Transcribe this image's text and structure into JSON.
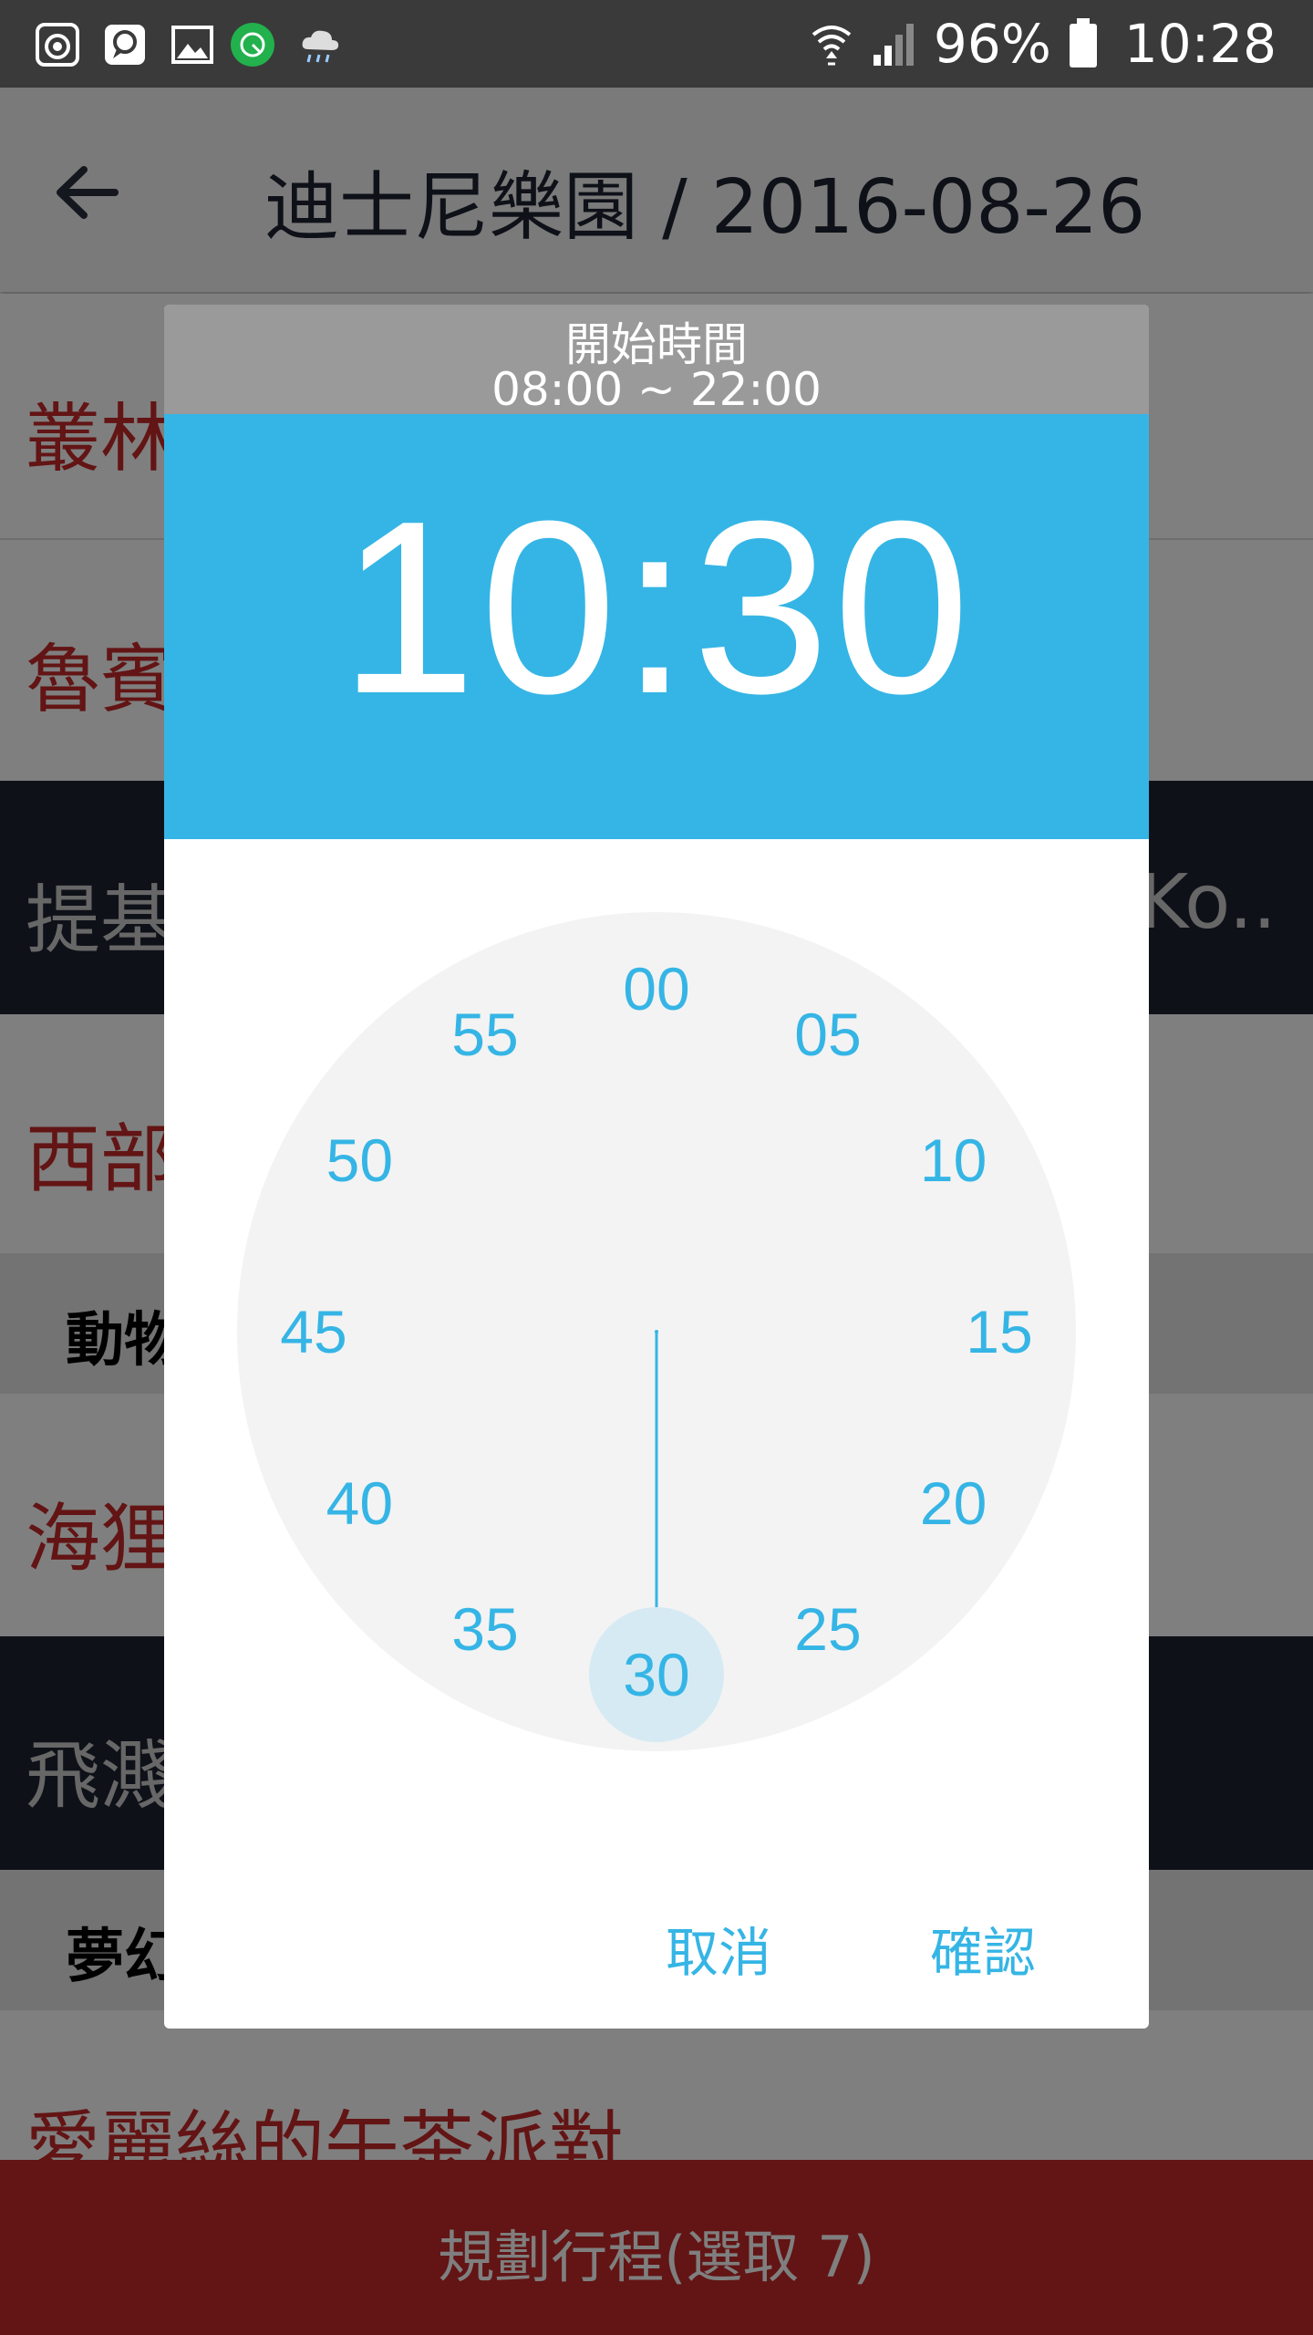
{
  "status_bar": {
    "battery": "96%",
    "time": "10:28",
    "left_icons": [
      "camera-icon",
      "message-icon",
      "gallery-icon",
      "app-icon",
      "weather-icon"
    ],
    "right_icons": [
      "wifi-icon",
      "signal-icon",
      "battery-icon"
    ]
  },
  "app_bar": {
    "title": "迪士尼樂園 / 2016-08-26"
  },
  "list": {
    "rows": [
      {
        "text": "叢林",
        "kind": "item"
      },
      {
        "text": "魯賓",
        "kind": "item"
      },
      {
        "text": "提基",
        "right_text": "Ko..",
        "kind": "dark"
      },
      {
        "text": "西部",
        "kind": "item"
      },
      {
        "text": "動物",
        "kind": "section"
      },
      {
        "text": "海狸",
        "kind": "item"
      },
      {
        "text": "飛濺",
        "kind": "dark"
      },
      {
        "text": "夢幻",
        "kind": "section"
      },
      {
        "text": "愛麗絲的午茶派對",
        "kind": "item"
      }
    ]
  },
  "bottom_bar": {
    "label": "規劃行程(選取 7)"
  },
  "dialog": {
    "title": "開始時間",
    "range": "08:00 ~ 22:00",
    "time": "10:30",
    "clock_numbers": [
      "00",
      "05",
      "10",
      "15",
      "20",
      "25",
      "30",
      "35",
      "40",
      "45",
      "50",
      "55"
    ],
    "selected_minute": "30",
    "cancel_label": "取消",
    "confirm_label": "確認"
  },
  "colors": {
    "accent": "#35b5e5",
    "red_text": "#c62828",
    "dark_row": "#1e2233",
    "bottom_bar": "#c62828"
  }
}
